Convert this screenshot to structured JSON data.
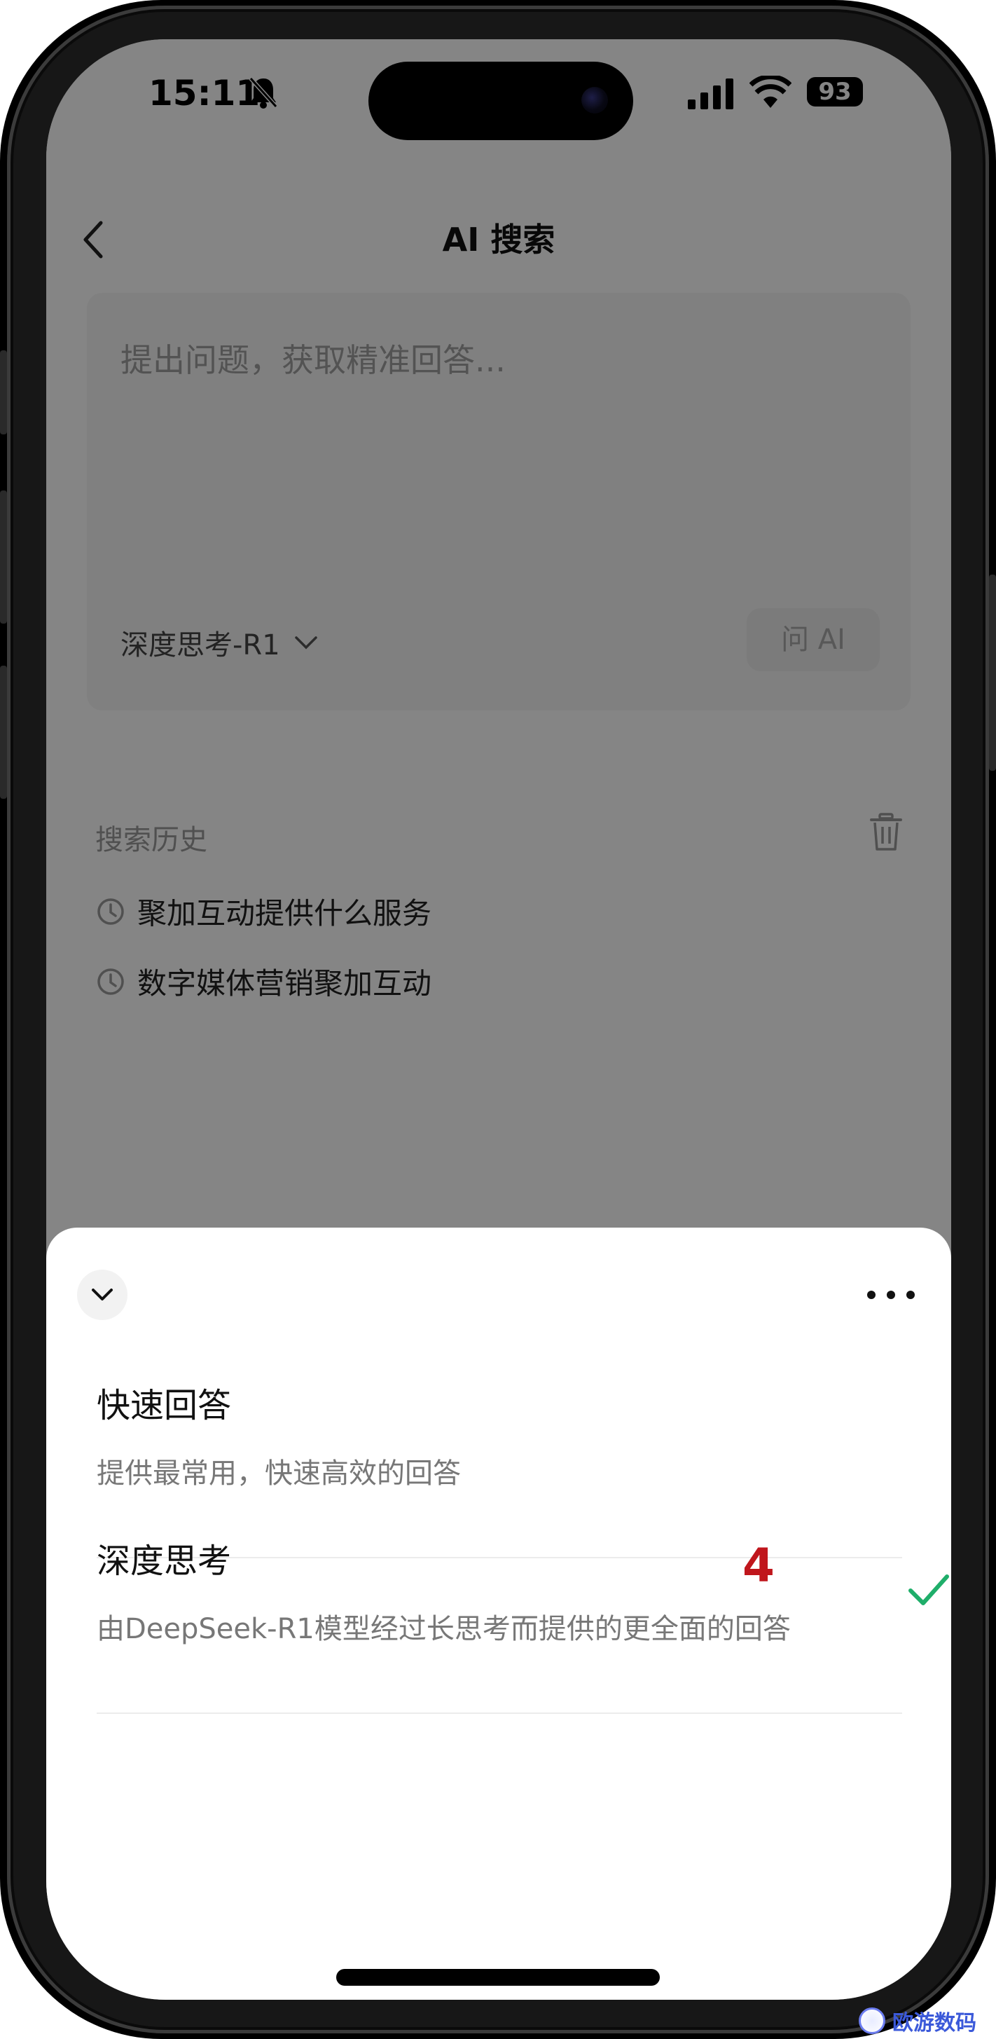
{
  "status_bar": {
    "time": "15:11",
    "battery": "93"
  },
  "nav": {
    "title": "AI 搜索"
  },
  "search": {
    "placeholder": "提出问题，获取精准回答...",
    "model_label": "深度思考-R1",
    "ask_button": "问 AI"
  },
  "history": {
    "title": "搜索历史",
    "items": [
      "聚加互动提供什么服务",
      "数字媒体营销聚加互动"
    ]
  },
  "sheet": {
    "options": [
      {
        "title": "快速回答",
        "description": "提供最常用，快速高效的回答",
        "selected": false
      },
      {
        "title": "深度思考",
        "description": "由DeepSeek-R1模型经过长思考而提供的更全面的回答",
        "selected": true
      }
    ],
    "annotation": "4"
  },
  "watermark": {
    "text": "欧游数码"
  },
  "colors": {
    "check": "#1fae6a",
    "annotation": "#c0161c",
    "watermark": "#3b59d9"
  }
}
